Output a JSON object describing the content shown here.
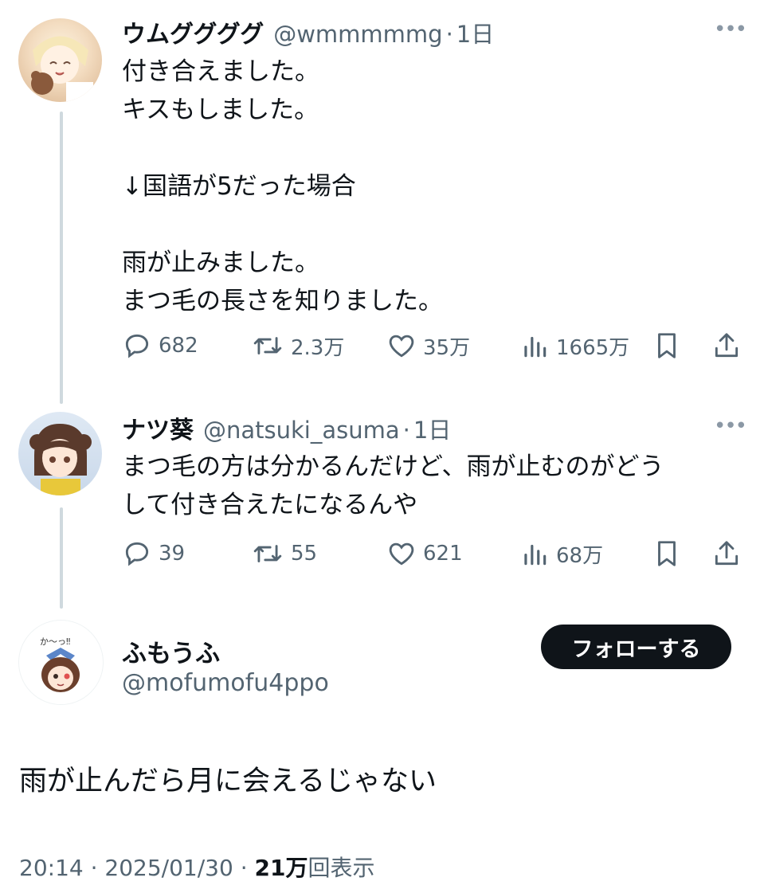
{
  "tweets": [
    {
      "name": "ウムググググ",
      "handle": "@wmmmmmg",
      "separator": "·",
      "time": "1日",
      "lines": [
        "付き合えました。",
        "キスもしました。",
        "",
        "↓国語が5だった場合",
        "",
        "雨が止みました。",
        "まつ毛の長さを知りました。"
      ],
      "replies": "682",
      "retweets": "2.3万",
      "likes": "35万",
      "views": "1665万"
    },
    {
      "name": "ナツ葵",
      "handle": "@natsuki_asuma",
      "separator": "·",
      "time": "1日",
      "lines": [
        "まつ毛の方は分かるんだけど、雨が止むのがどう",
        "して付き合えたになるんや"
      ],
      "replies": "39",
      "retweets": "55",
      "likes": "621",
      "views": "68万"
    }
  ],
  "main": {
    "name": "ふもうふ",
    "handle": "@mofumofu4ppo",
    "follow_label": "フォローする",
    "avatar_text": "か〜っ‼",
    "text": "雨が止んだら月に会えるじゃない",
    "time": "20:14",
    "separator": "·",
    "date": "2025/01/30",
    "views_count": "21万",
    "views_label": "回表示"
  },
  "colors": {
    "text": "#0f1419",
    "secondary": "#536471",
    "thread_line": "#cfd9de",
    "button_bg": "#0f1419"
  }
}
